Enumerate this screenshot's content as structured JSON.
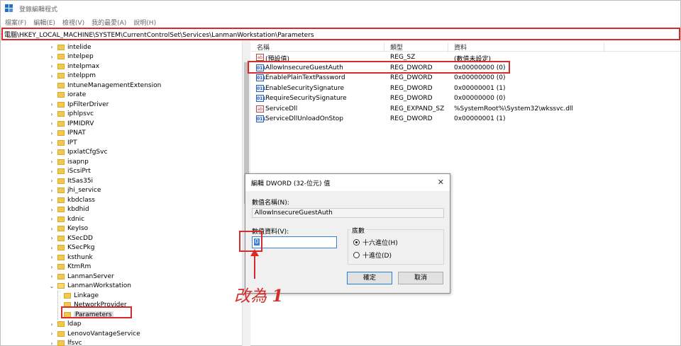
{
  "window": {
    "title": "登錄編輯程式",
    "menu": [
      "檔案(F)",
      "編輯(E)",
      "檢視(V)",
      "我的最愛(A)",
      "說明(H)"
    ],
    "address": "電腦\\HKEY_LOCAL_MACHINE\\SYSTEM\\CurrentControlSet\\Services\\LanmanWorkstation\\Parameters"
  },
  "tree": {
    "items": [
      {
        "label": "intelide",
        "expandable": true
      },
      {
        "label": "intelpep",
        "expandable": true
      },
      {
        "label": "intelpmax",
        "expandable": true
      },
      {
        "label": "intelppm",
        "expandable": true
      },
      {
        "label": "IntuneManagementExtension",
        "expandable": false
      },
      {
        "label": "iorate",
        "expandable": false
      },
      {
        "label": "IpFilterDriver",
        "expandable": true
      },
      {
        "label": "iphlpsvc",
        "expandable": true
      },
      {
        "label": "IPMIDRV",
        "expandable": true
      },
      {
        "label": "IPNAT",
        "expandable": true
      },
      {
        "label": "IPT",
        "expandable": true
      },
      {
        "label": "IpxlatCfgSvc",
        "expandable": true
      },
      {
        "label": "isapnp",
        "expandable": true
      },
      {
        "label": "iScsiPrt",
        "expandable": true
      },
      {
        "label": "ItSas35i",
        "expandable": true
      },
      {
        "label": "jhi_service",
        "expandable": true
      },
      {
        "label": "kbdclass",
        "expandable": true
      },
      {
        "label": "kbdhid",
        "expandable": true
      },
      {
        "label": "kdnic",
        "expandable": true
      },
      {
        "label": "KeyIso",
        "expandable": true
      },
      {
        "label": "KSecDD",
        "expandable": true
      },
      {
        "label": "KSecPkg",
        "expandable": true
      },
      {
        "label": "ksthunk",
        "expandable": true
      },
      {
        "label": "KtmRm",
        "expandable": true
      },
      {
        "label": "LanmanServer",
        "expandable": true
      },
      {
        "label": "LanmanWorkstation",
        "expandable": true,
        "expanded": true
      },
      {
        "label": "Linkage",
        "expandable": false,
        "child": true
      },
      {
        "label": "NetworkProvider",
        "expandable": false,
        "child": true
      },
      {
        "label": "Parameters",
        "expandable": false,
        "child": true,
        "selected": true
      },
      {
        "label": "ldap",
        "expandable": true
      },
      {
        "label": "LenovoVantageService",
        "expandable": true
      },
      {
        "label": "lfsvc",
        "expandable": true
      }
    ]
  },
  "list": {
    "headers": {
      "name": "名稱",
      "type": "類型",
      "data": "資料"
    },
    "rows": [
      {
        "icon": "string-value-icon",
        "name": "(預設值)",
        "type": "REG_SZ",
        "data": "(數值未設定)"
      },
      {
        "icon": "binary-value-icon",
        "name": "AllowInsecureGuestAuth",
        "type": "REG_DWORD",
        "data": "0x00000000 (0)"
      },
      {
        "icon": "binary-value-icon",
        "name": "EnablePlainTextPassword",
        "type": "REG_DWORD",
        "data": "0x00000000 (0)"
      },
      {
        "icon": "binary-value-icon",
        "name": "EnableSecuritySignature",
        "type": "REG_DWORD",
        "data": "0x00000001 (1)"
      },
      {
        "icon": "binary-value-icon",
        "name": "RequireSecuritySignature",
        "type": "REG_DWORD",
        "data": "0x00000000 (0)"
      },
      {
        "icon": "string-value-icon",
        "name": "ServiceDll",
        "type": "REG_EXPAND_SZ",
        "data": "%SystemRoot%\\System32\\wkssvc.dll"
      },
      {
        "icon": "binary-value-icon",
        "name": "ServiceDllUnloadOnStop",
        "type": "REG_DWORD",
        "data": "0x00000001 (1)"
      }
    ]
  },
  "dialog": {
    "title": "編輯 DWORD (32-位元) 值",
    "close": "✕",
    "name_label": "數值名稱(N):",
    "name_value": "AllowInsecureGuestAuth",
    "data_label": "數值資料(V):",
    "data_value": "0",
    "base_label": "底數",
    "hex_label": "十六進位(H)",
    "dec_label": "十進位(D)",
    "ok": "確定",
    "cancel": "取消"
  },
  "annotation": {
    "text": "改為",
    "number": "1"
  },
  "colors": {
    "highlight": "#d62b2b",
    "folder": "#f2c94c",
    "selection": "#3c7fd6"
  }
}
